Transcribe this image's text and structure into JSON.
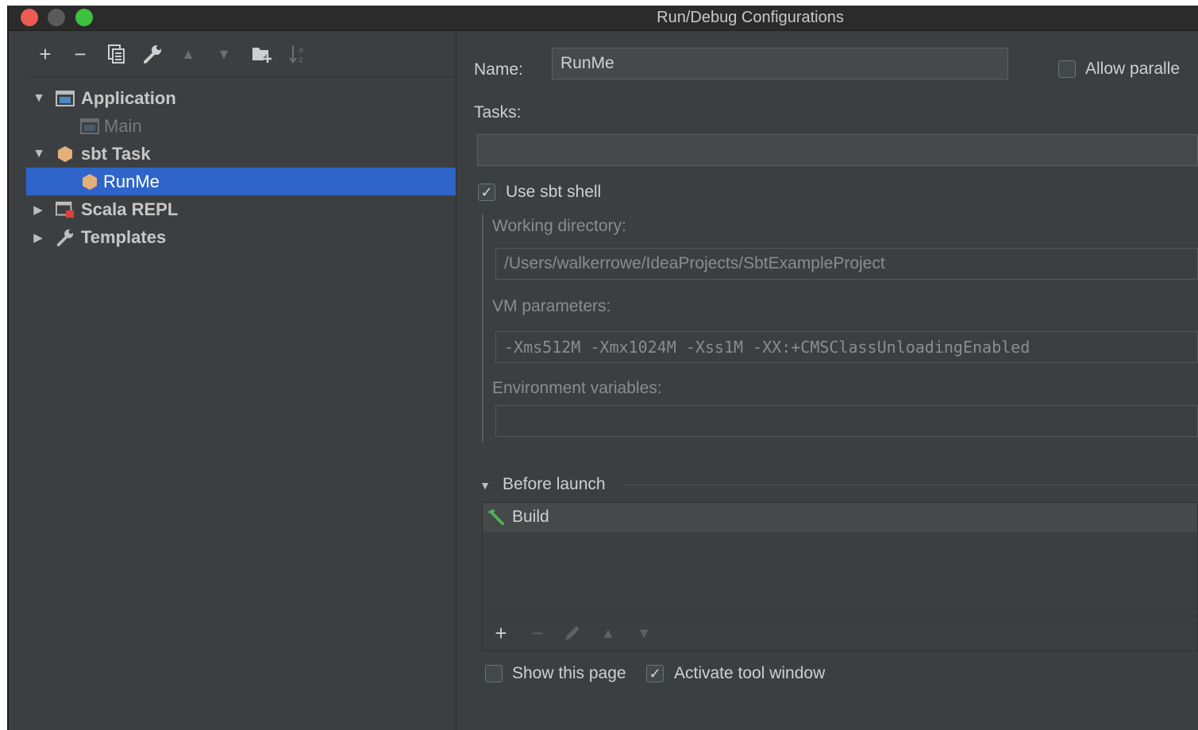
{
  "window": {
    "title": "Run/Debug Configurations"
  },
  "toolbar": {
    "add": "+",
    "remove": "−",
    "up": "▲",
    "down": "▼"
  },
  "tree": [
    {
      "label": "Application",
      "icon": "application-icon",
      "expanded": true
    },
    {
      "label": "Main",
      "icon": "application-icon"
    },
    {
      "label": "sbt Task",
      "icon": "sbt-icon",
      "expanded": true
    },
    {
      "label": "RunMe",
      "icon": "sbt-icon",
      "selected": true
    },
    {
      "label": "Scala REPL",
      "icon": "scala-repl-icon",
      "expanded": false
    },
    {
      "label": "Templates",
      "icon": "wrench-icon",
      "expanded": false
    }
  ],
  "form": {
    "name_label": "Name:",
    "name_value": "RunMe",
    "allow_parallel_label": "Allow paralle",
    "tasks_label": "Tasks:",
    "tasks_value": "",
    "use_sbt_shell_label": "Use sbt shell",
    "working_dir_label": "Working directory:",
    "working_dir_value": "/Users/walkerrowe/IdeaProjects/SbtExampleProject",
    "vm_params_label": "VM parameters:",
    "vm_params_value": "-Xms512M -Xmx1024M -Xss1M -XX:+CMSClassUnloadingEnabled",
    "env_vars_label": "Environment variables:",
    "env_vars_value": ""
  },
  "before_launch": {
    "title": "Before launch",
    "items": [
      {
        "label": "Build",
        "icon": "hammer-icon"
      }
    ],
    "tools": {
      "add": "+",
      "remove": "−",
      "up": "▲",
      "down": "▼"
    }
  },
  "footer": {
    "show_page_label": "Show this page",
    "activate_tool_window_label": "Activate tool window"
  },
  "checks": {
    "checked": "✓"
  },
  "colors": {
    "selection": "#2f65ca",
    "background": "#3c3f41",
    "hammer": "#4fb05a",
    "sbt": "#e3b07a"
  }
}
